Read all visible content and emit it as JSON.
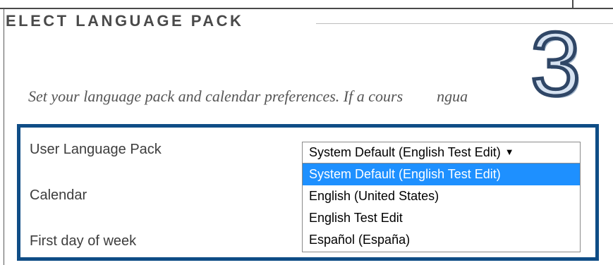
{
  "section": {
    "title": "ELECT LANGUAGE PACK"
  },
  "intro_text": "Set your language pack and calendar preferences. If a cours",
  "intro_text_tail": "ngua",
  "step_number": "3",
  "form": {
    "language_pack_label": "User Language Pack",
    "calendar_label": "Calendar",
    "first_day_label": "First day of week",
    "language_pack_value": "System Default (English Test Edit)",
    "language_pack_arrow": "▼",
    "language_pack_options": [
      {
        "label": "System Default (English Test Edit)",
        "selected": true
      },
      {
        "label": "English (United States)",
        "selected": false
      },
      {
        "label": "English Test Edit",
        "selected": false
      },
      {
        "label": "Español (España)",
        "selected": false
      }
    ]
  },
  "colors": {
    "highlight_border": "#0f4d86",
    "selected_option_bg": "#1e90ff",
    "step_number_fill": "#d6e2f1",
    "step_number_stroke": "#2f4666"
  },
  "icons": {
    "dropdown": "triangle-down-icon"
  }
}
